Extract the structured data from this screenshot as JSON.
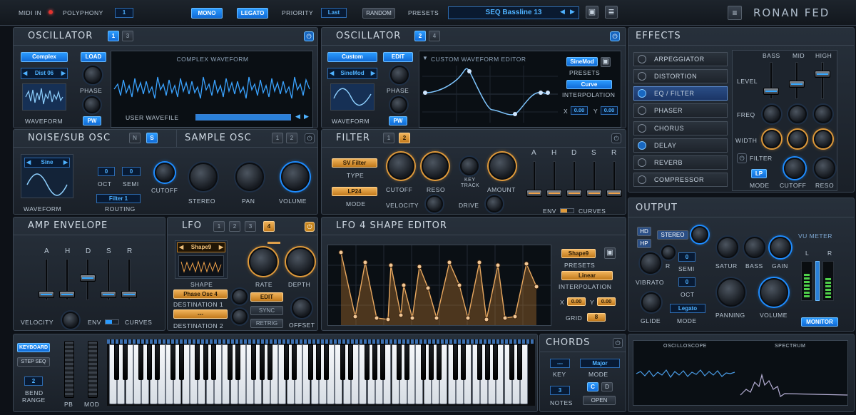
{
  "topbar": {
    "midi_in": "MIDI IN",
    "polyphony_label": "POLYPHONY",
    "polyphony_value": "1",
    "mono": "MONO",
    "legato": "LEGATO",
    "priority_label": "PRIORITY",
    "priority_value": "Last",
    "random": "RANDOM",
    "presets_label": "PRESETS",
    "preset_name": "SEQ Bassline 13",
    "logo": "RONAN FED"
  },
  "osc1": {
    "title": "OSCILLATOR",
    "tab1": "1",
    "tab2": "3",
    "type": "Complex",
    "load": "LOAD",
    "wave_select": "Dist 06",
    "phase": "PHASE",
    "waveform": "WAVEFORM",
    "pw": "PW",
    "display_title": "COMPLEX WAVEFORM",
    "user_wavefile": "USER WAVEFILE"
  },
  "osc2": {
    "title": "OSCILLATOR",
    "tab1": "2",
    "tab2": "4",
    "type": "Custom",
    "edit": "EDIT",
    "wave_select": "SineMod",
    "phase": "PHASE",
    "waveform": "WAVEFORM",
    "pw": "PW",
    "editor_title": "CUSTOM WAVEFORM EDITOR",
    "preset": "SineMod",
    "presets": "PRESETS",
    "interp_value": "Curve",
    "interpolation": "INTERPOLATION",
    "x_label": "X",
    "x_value": "0.00",
    "y_label": "Y",
    "y_value": "0.00"
  },
  "noise": {
    "title": "NOISE/SUB OSC",
    "n": "N",
    "s": "S",
    "wave": "Sine",
    "oct_value": "0",
    "semi_value": "0",
    "oct": "OCT",
    "semi": "SEMI",
    "routing_value": "Filter 1",
    "routing": "ROUTING",
    "cutoff": "CUTOFF",
    "waveform": "WAVEFORM"
  },
  "sample": {
    "title": "SAMPLE OSC",
    "tab1": "1",
    "tab2": "2",
    "stereo": "STEREO",
    "pan": "PAN",
    "volume": "VOLUME"
  },
  "filter": {
    "title": "FILTER",
    "tab1": "1",
    "tab2": "2",
    "type_value": "SV Filter",
    "type": "TYPE",
    "mode_value": "LP24",
    "mode": "MODE",
    "cutoff": "CUTOFF",
    "reso": "RESO",
    "key": "KEY",
    "track": "TRACK",
    "amount": "AMOUNT",
    "velocity": "VELOCITY",
    "drive": "DRIVE",
    "env_letters": [
      "A",
      "H",
      "D",
      "S",
      "R"
    ],
    "env": "ENV",
    "curves": "CURVES"
  },
  "amp": {
    "title": "AMP ENVELOPE",
    "letters": [
      "A",
      "H",
      "D",
      "S",
      "R"
    ],
    "velocity": "VELOCITY",
    "env": "ENV",
    "curves": "CURVES"
  },
  "lfo": {
    "title": "LFO",
    "tabs": [
      "1",
      "2",
      "3",
      "4"
    ],
    "shape_value": "Shape9",
    "shape": "SHAPE",
    "dest1_value": "Phase Osc 4",
    "dest1": "DESTINATION 1",
    "dest2_value": "---",
    "dest2": "DESTINATION 2",
    "rate": "RATE",
    "depth": "DEPTH",
    "edit": "EDIT",
    "sync": "SYNC",
    "retrig": "RETRIG",
    "offset": "OFFSET"
  },
  "lfo_editor": {
    "title": "LFO 4 SHAPE EDITOR",
    "preset": "Shape9",
    "presets": "PRESETS",
    "interp_value": "Linear",
    "interpolation": "INTERPOLATION",
    "x_label": "X",
    "x_value": "0.00",
    "y_label": "Y",
    "y_value": "0.00",
    "grid": "GRID",
    "grid_value": "8"
  },
  "effects": {
    "title": "EFFECTS",
    "items": [
      "ARPEGGIATOR",
      "DISTORTION",
      "EQ / FILTER",
      "PHASER",
      "CHORUS",
      "DELAY",
      "REVERB",
      "COMPRESSOR"
    ],
    "selected": "EQ / FILTER",
    "bass": "BASS",
    "mid": "MID",
    "high": "HIGH",
    "level": "LEVEL",
    "freq": "FREQ",
    "width": "WIDTH",
    "filter": "FILTER",
    "lp": "LP",
    "mode": "MODE",
    "cutoff": "CUTOFF",
    "reso": "RESO"
  },
  "output": {
    "title": "OUTPUT",
    "hd": "HD",
    "hp": "HP",
    "stereo": "STEREO",
    "semi_value": "0",
    "semi": "SEMI",
    "r": "R",
    "oct_value": "0",
    "oct": "OCT",
    "vibrato": "VIBRATO",
    "glide": "GLIDE",
    "mode_value": "Legato",
    "mode": "MODE",
    "satur": "SATUR",
    "bass": "BASS",
    "gain": "GAIN",
    "panning": "PANNING",
    "volume": "VOLUME",
    "vu_meter": "VU METER",
    "l": "L",
    "vr": "R",
    "monitor": "MONITOR"
  },
  "keyboard": {
    "keyboard": "KEYBOARD",
    "step_seq": "STEP SEQ",
    "bend_value": "2",
    "bend": "BEND",
    "range": "RANGE",
    "pb": "PB",
    "mod": "MOD"
  },
  "chords": {
    "title": "CHORDS",
    "key_value": "---",
    "key": "KEY",
    "mode_value": "Major",
    "mode": "MODE",
    "notes_value": "3",
    "notes": "NOTES",
    "c": "C",
    "d": "D",
    "open": "OPEN"
  },
  "scope": {
    "oscilloscope": "OSCILLOSCOPE",
    "spectrum": "SPECTRUM"
  },
  "colors": {
    "accent_blue": "#2a9bff",
    "accent_orange": "#f0a24a",
    "bg": "#0d1117"
  }
}
